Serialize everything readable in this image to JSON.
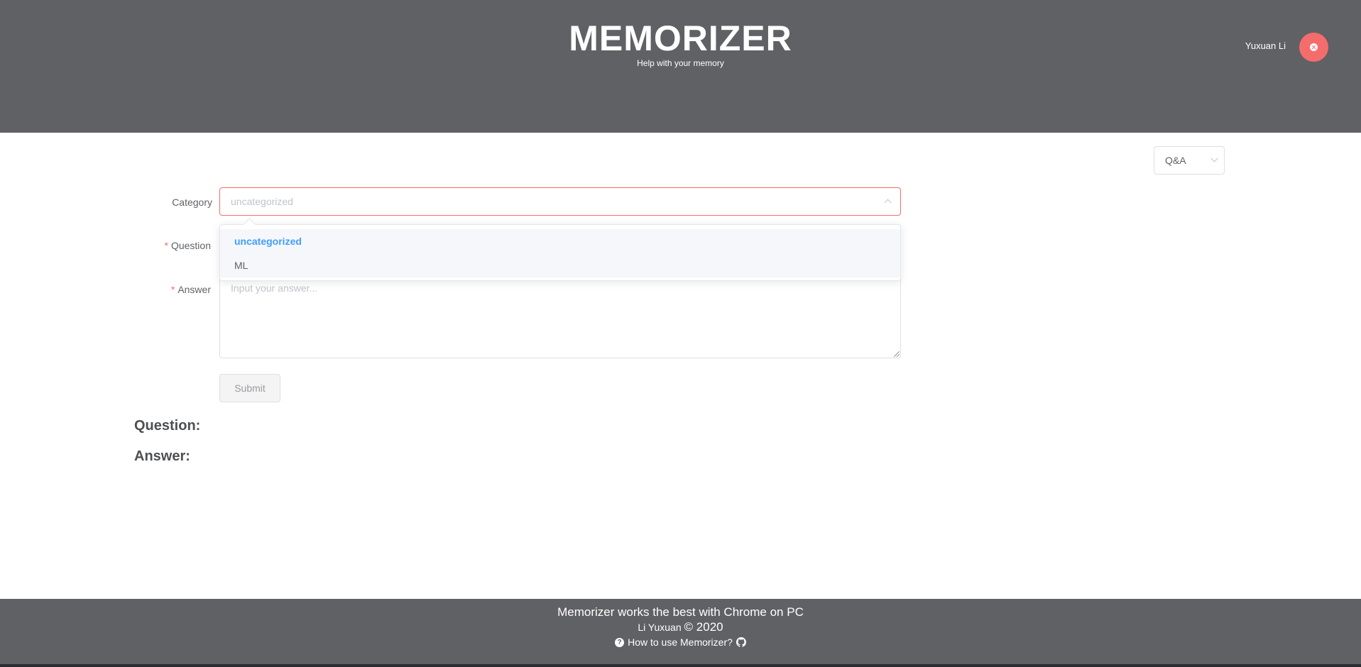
{
  "header": {
    "title": "MEMORIZER",
    "subtitle": "Help with your memory",
    "user_name": "Yuxuan Li",
    "background_color": "#606165",
    "avatar_color": "#f56c6c"
  },
  "mode_select": {
    "value": "Q&A"
  },
  "form": {
    "category_label": "Category",
    "category_placeholder": "uncategorized",
    "category_options": [
      {
        "label": "uncategorized",
        "selected": true
      },
      {
        "label": "ML",
        "selected": false
      }
    ],
    "required_mark": "*",
    "question_label": "Question",
    "answer_label": "Answer",
    "answer_placeholder": "Input your answer...",
    "submit_label": "Submit"
  },
  "result": {
    "question_label": "Question:",
    "answer_label": "Answer:"
  },
  "footer": {
    "line1": "Memorizer works the best with Chrome on PC",
    "author": "Li Yuxuan",
    "copyright": "© 2020",
    "help_link": "How to use Memorizer?"
  }
}
